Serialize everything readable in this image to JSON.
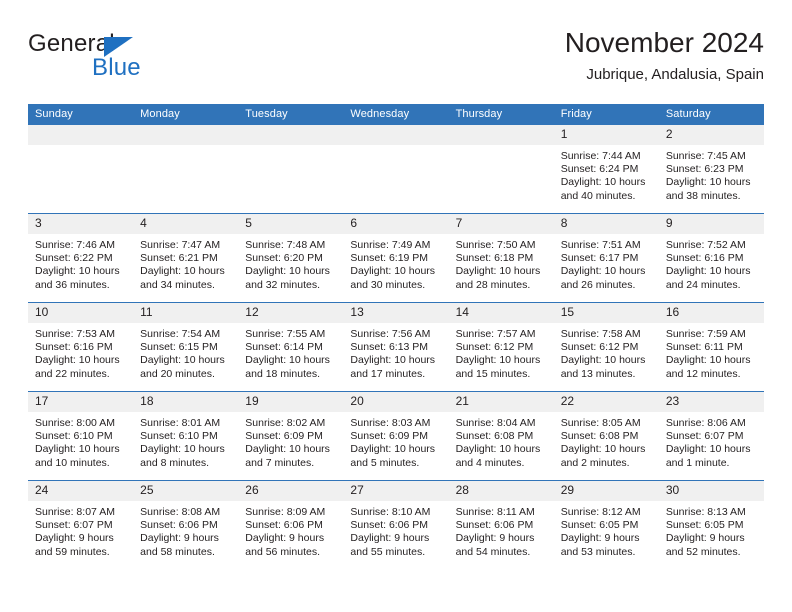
{
  "brand": {
    "name_primary": "General",
    "name_secondary": "Blue",
    "primary_color": "#231f20",
    "accent_color": "#1f70c1"
  },
  "header": {
    "title": "November 2024",
    "subtitle": "Jubrique, Andalusia, Spain"
  },
  "calendar": {
    "header_bg": "#3174b8",
    "header_text_color": "#ffffff",
    "daynum_bg": "#f0f0f0",
    "weekday_headers": [
      "Sunday",
      "Monday",
      "Tuesday",
      "Wednesday",
      "Thursday",
      "Friday",
      "Saturday"
    ],
    "labels": {
      "sunrise": "Sunrise:",
      "sunset": "Sunset:",
      "daylight": "Daylight:"
    },
    "weeks": [
      [
        {
          "day": "",
          "empty": true
        },
        {
          "day": "",
          "empty": true
        },
        {
          "day": "",
          "empty": true
        },
        {
          "day": "",
          "empty": true
        },
        {
          "day": "",
          "empty": true
        },
        {
          "day": "1",
          "sunrise": "Sunrise: 7:44 AM",
          "sunset": "Sunset: 6:24 PM",
          "daylight_1": "Daylight: 10 hours",
          "daylight_2": "and 40 minutes."
        },
        {
          "day": "2",
          "sunrise": "Sunrise: 7:45 AM",
          "sunset": "Sunset: 6:23 PM",
          "daylight_1": "Daylight: 10 hours",
          "daylight_2": "and 38 minutes."
        }
      ],
      [
        {
          "day": "3",
          "sunrise": "Sunrise: 7:46 AM",
          "sunset": "Sunset: 6:22 PM",
          "daylight_1": "Daylight: 10 hours",
          "daylight_2": "and 36 minutes."
        },
        {
          "day": "4",
          "sunrise": "Sunrise: 7:47 AM",
          "sunset": "Sunset: 6:21 PM",
          "daylight_1": "Daylight: 10 hours",
          "daylight_2": "and 34 minutes."
        },
        {
          "day": "5",
          "sunrise": "Sunrise: 7:48 AM",
          "sunset": "Sunset: 6:20 PM",
          "daylight_1": "Daylight: 10 hours",
          "daylight_2": "and 32 minutes."
        },
        {
          "day": "6",
          "sunrise": "Sunrise: 7:49 AM",
          "sunset": "Sunset: 6:19 PM",
          "daylight_1": "Daylight: 10 hours",
          "daylight_2": "and 30 minutes."
        },
        {
          "day": "7",
          "sunrise": "Sunrise: 7:50 AM",
          "sunset": "Sunset: 6:18 PM",
          "daylight_1": "Daylight: 10 hours",
          "daylight_2": "and 28 minutes."
        },
        {
          "day": "8",
          "sunrise": "Sunrise: 7:51 AM",
          "sunset": "Sunset: 6:17 PM",
          "daylight_1": "Daylight: 10 hours",
          "daylight_2": "and 26 minutes."
        },
        {
          "day": "9",
          "sunrise": "Sunrise: 7:52 AM",
          "sunset": "Sunset: 6:16 PM",
          "daylight_1": "Daylight: 10 hours",
          "daylight_2": "and 24 minutes."
        }
      ],
      [
        {
          "day": "10",
          "sunrise": "Sunrise: 7:53 AM",
          "sunset": "Sunset: 6:16 PM",
          "daylight_1": "Daylight: 10 hours",
          "daylight_2": "and 22 minutes."
        },
        {
          "day": "11",
          "sunrise": "Sunrise: 7:54 AM",
          "sunset": "Sunset: 6:15 PM",
          "daylight_1": "Daylight: 10 hours",
          "daylight_2": "and 20 minutes."
        },
        {
          "day": "12",
          "sunrise": "Sunrise: 7:55 AM",
          "sunset": "Sunset: 6:14 PM",
          "daylight_1": "Daylight: 10 hours",
          "daylight_2": "and 18 minutes."
        },
        {
          "day": "13",
          "sunrise": "Sunrise: 7:56 AM",
          "sunset": "Sunset: 6:13 PM",
          "daylight_1": "Daylight: 10 hours",
          "daylight_2": "and 17 minutes."
        },
        {
          "day": "14",
          "sunrise": "Sunrise: 7:57 AM",
          "sunset": "Sunset: 6:12 PM",
          "daylight_1": "Daylight: 10 hours",
          "daylight_2": "and 15 minutes."
        },
        {
          "day": "15",
          "sunrise": "Sunrise: 7:58 AM",
          "sunset": "Sunset: 6:12 PM",
          "daylight_1": "Daylight: 10 hours",
          "daylight_2": "and 13 minutes."
        },
        {
          "day": "16",
          "sunrise": "Sunrise: 7:59 AM",
          "sunset": "Sunset: 6:11 PM",
          "daylight_1": "Daylight: 10 hours",
          "daylight_2": "and 12 minutes."
        }
      ],
      [
        {
          "day": "17",
          "sunrise": "Sunrise: 8:00 AM",
          "sunset": "Sunset: 6:10 PM",
          "daylight_1": "Daylight: 10 hours",
          "daylight_2": "and 10 minutes."
        },
        {
          "day": "18",
          "sunrise": "Sunrise: 8:01 AM",
          "sunset": "Sunset: 6:10 PM",
          "daylight_1": "Daylight: 10 hours",
          "daylight_2": "and 8 minutes."
        },
        {
          "day": "19",
          "sunrise": "Sunrise: 8:02 AM",
          "sunset": "Sunset: 6:09 PM",
          "daylight_1": "Daylight: 10 hours",
          "daylight_2": "and 7 minutes."
        },
        {
          "day": "20",
          "sunrise": "Sunrise: 8:03 AM",
          "sunset": "Sunset: 6:09 PM",
          "daylight_1": "Daylight: 10 hours",
          "daylight_2": "and 5 minutes."
        },
        {
          "day": "21",
          "sunrise": "Sunrise: 8:04 AM",
          "sunset": "Sunset: 6:08 PM",
          "daylight_1": "Daylight: 10 hours",
          "daylight_2": "and 4 minutes."
        },
        {
          "day": "22",
          "sunrise": "Sunrise: 8:05 AM",
          "sunset": "Sunset: 6:08 PM",
          "daylight_1": "Daylight: 10 hours",
          "daylight_2": "and 2 minutes."
        },
        {
          "day": "23",
          "sunrise": "Sunrise: 8:06 AM",
          "sunset": "Sunset: 6:07 PM",
          "daylight_1": "Daylight: 10 hours",
          "daylight_2": "and 1 minute."
        }
      ],
      [
        {
          "day": "24",
          "sunrise": "Sunrise: 8:07 AM",
          "sunset": "Sunset: 6:07 PM",
          "daylight_1": "Daylight: 9 hours",
          "daylight_2": "and 59 minutes."
        },
        {
          "day": "25",
          "sunrise": "Sunrise: 8:08 AM",
          "sunset": "Sunset: 6:06 PM",
          "daylight_1": "Daylight: 9 hours",
          "daylight_2": "and 58 minutes."
        },
        {
          "day": "26",
          "sunrise": "Sunrise: 8:09 AM",
          "sunset": "Sunset: 6:06 PM",
          "daylight_1": "Daylight: 9 hours",
          "daylight_2": "and 56 minutes."
        },
        {
          "day": "27",
          "sunrise": "Sunrise: 8:10 AM",
          "sunset": "Sunset: 6:06 PM",
          "daylight_1": "Daylight: 9 hours",
          "daylight_2": "and 55 minutes."
        },
        {
          "day": "28",
          "sunrise": "Sunrise: 8:11 AM",
          "sunset": "Sunset: 6:06 PM",
          "daylight_1": "Daylight: 9 hours",
          "daylight_2": "and 54 minutes."
        },
        {
          "day": "29",
          "sunrise": "Sunrise: 8:12 AM",
          "sunset": "Sunset: 6:05 PM",
          "daylight_1": "Daylight: 9 hours",
          "daylight_2": "and 53 minutes."
        },
        {
          "day": "30",
          "sunrise": "Sunrise: 8:13 AM",
          "sunset": "Sunset: 6:05 PM",
          "daylight_1": "Daylight: 9 hours",
          "daylight_2": "and 52 minutes."
        }
      ]
    ]
  }
}
